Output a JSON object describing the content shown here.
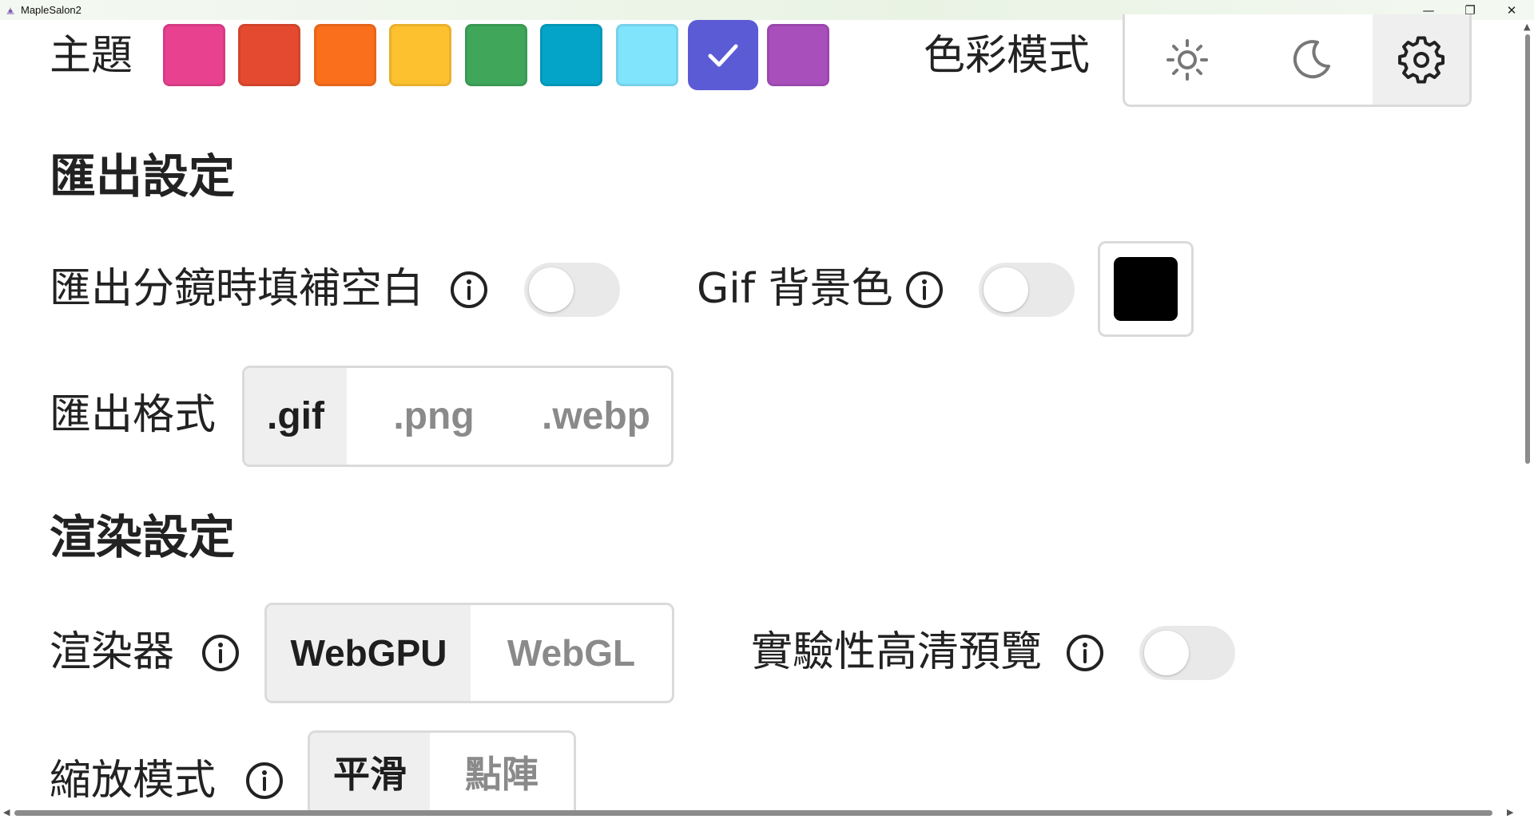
{
  "window": {
    "title": "MapleSalon2",
    "minimize_glyph": "—",
    "maximize_glyph": "❐",
    "close_glyph": "✕"
  },
  "theme": {
    "label": "主題",
    "swatches": [
      {
        "name": "pink",
        "color": "#e8418f"
      },
      {
        "name": "red",
        "color": "#e34a2f"
      },
      {
        "name": "orange",
        "color": "#f96f1c"
      },
      {
        "name": "yellow",
        "color": "#fdc02f"
      },
      {
        "name": "green",
        "color": "#3fa65a"
      },
      {
        "name": "teal",
        "color": "#04a4c8"
      },
      {
        "name": "light-blue",
        "color": "#80e4fd"
      },
      {
        "name": "indigo",
        "color": "#5b5bd6",
        "selected": true
      },
      {
        "name": "purple",
        "color": "#a94fbc"
      }
    ]
  },
  "color_mode": {
    "label": "色彩模式",
    "options": [
      {
        "icon": "sun-icon",
        "active": false
      },
      {
        "icon": "moon-icon",
        "active": false
      },
      {
        "icon": "gear-icon",
        "active": true
      }
    ]
  },
  "export_settings": {
    "heading": "匯出設定",
    "fill_blank_label": "匯出分鏡時填補空白",
    "fill_blank_on": false,
    "gif_bg_label": "Gif 背景色",
    "gif_bg_on": false,
    "gif_bg_color": "#000000",
    "format_label": "匯出格式",
    "formats": [
      ".gif",
      ".png",
      ".webp"
    ],
    "selected_format": ".gif"
  },
  "render_settings": {
    "heading": "渲染設定",
    "renderer_label": "渲染器",
    "renderers": [
      "WebGPU",
      "WebGL"
    ],
    "selected_renderer": "WebGPU",
    "hd_preview_label": "實驗性高清預覽",
    "hd_preview_on": false,
    "scale_mode_label": "縮放模式",
    "scale_modes": [
      "平滑",
      "點陣"
    ],
    "selected_scale_mode": "平滑"
  }
}
